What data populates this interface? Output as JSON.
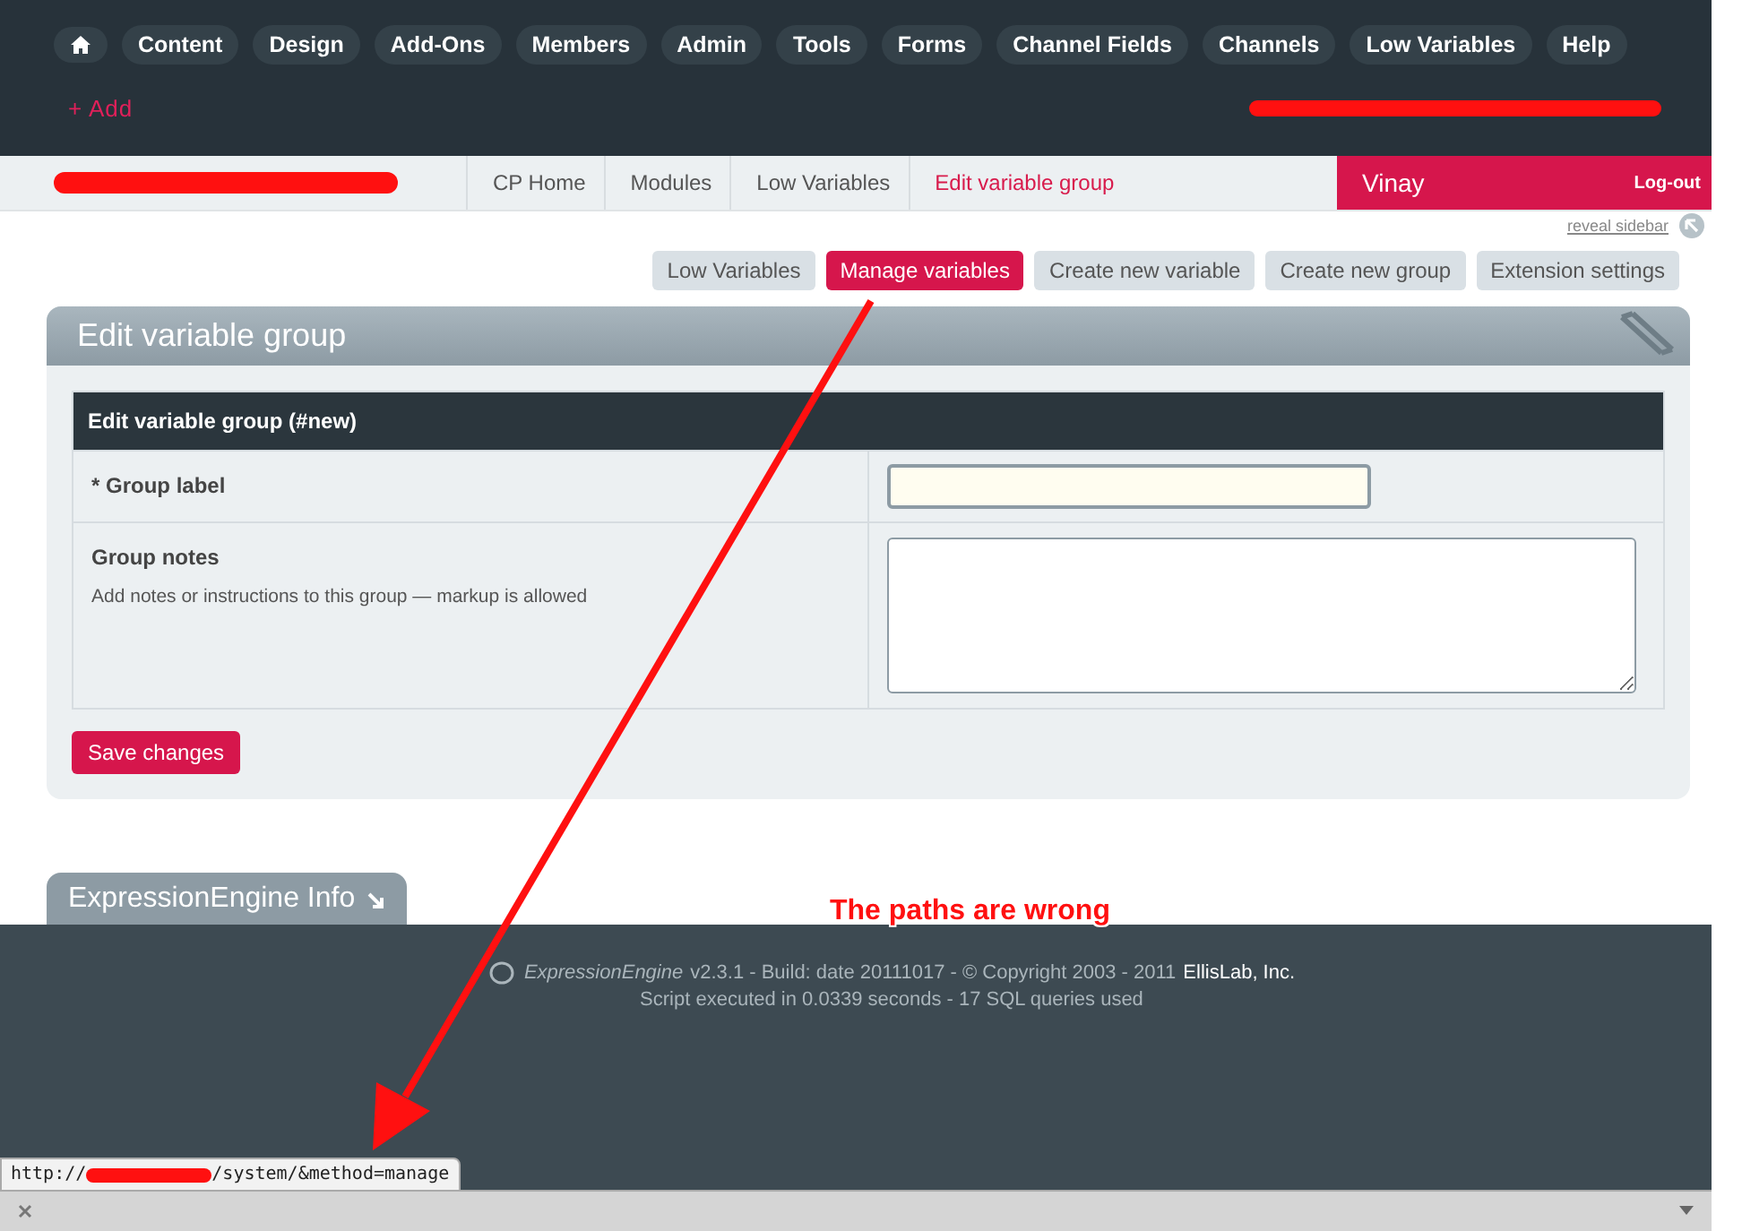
{
  "nav": {
    "items": [
      {
        "label": "Content"
      },
      {
        "label": "Design"
      },
      {
        "label": "Add-Ons"
      },
      {
        "label": "Members"
      },
      {
        "label": "Admin"
      },
      {
        "label": "Tools"
      },
      {
        "label": "Forms"
      },
      {
        "label": "Channel Fields"
      },
      {
        "label": "Channels"
      },
      {
        "label": "Low Variables"
      },
      {
        "label": "Help"
      }
    ],
    "add": "+ Add"
  },
  "breadcrumbs": [
    {
      "label": "CP Home",
      "current": false
    },
    {
      "label": "Modules",
      "current": false
    },
    {
      "label": "Low Variables",
      "current": false
    },
    {
      "label": "Edit variable group",
      "current": true
    }
  ],
  "user": {
    "name": "Vinay",
    "logout": "Log-out"
  },
  "reveal_sidebar": "reveal sidebar",
  "tabs": [
    {
      "label": "Low Variables",
      "selected": false
    },
    {
      "label": "Manage variables",
      "selected": true
    },
    {
      "label": "Create new variable",
      "selected": false
    },
    {
      "label": "Create new group",
      "selected": false
    },
    {
      "label": "Extension settings",
      "selected": false
    }
  ],
  "panel": {
    "title": "Edit variable group",
    "table_title": "Edit variable group (#new)",
    "rows": [
      {
        "label": "* Group label",
        "kind": "input"
      },
      {
        "label": "Group notes",
        "note": "Add notes or instructions to this group — markup is allowed",
        "kind": "textarea"
      }
    ],
    "save": "Save changes"
  },
  "info_tab": "ExpressionEngine Info",
  "annotation": "The paths are wrong",
  "footer": {
    "product": "ExpressionEngine",
    "build": "v2.3.1 - Build: date  20111017 - © Copyright 2003 - 2011",
    "company": "EllisLab, Inc.",
    "stats": "Script executed in 0.0339 seconds - 17 SQL queries used"
  },
  "status_url": {
    "prefix": "http://",
    "suffix": "/system/&method=manage"
  }
}
